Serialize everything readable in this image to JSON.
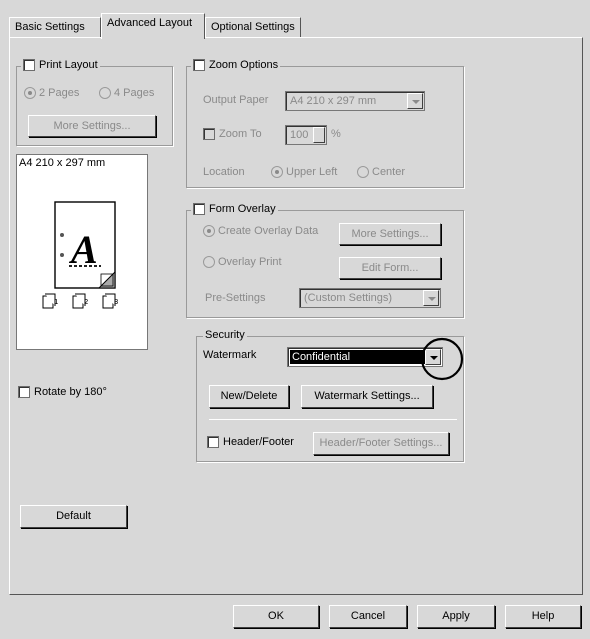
{
  "tabs": [
    "Basic Settings",
    "Advanced Layout",
    "Optional Settings"
  ],
  "print_layout": {
    "title": "Print Layout",
    "radio_2pages": "2 Pages",
    "radio_4pages": "4 Pages",
    "more_settings": "More Settings..."
  },
  "preview": {
    "paper_label": "A4 210 x 297 mm",
    "letter": "A"
  },
  "rotate": "Rotate by 180°",
  "default_button": "Default",
  "zoom": {
    "title": "Zoom Options",
    "output_paper_label": "Output Paper",
    "output_paper_value": "A4 210 x 297 mm",
    "zoom_to_label": "Zoom To",
    "zoom_value": "100",
    "percent": "%",
    "location_label": "Location",
    "upper_left": "Upper Left",
    "center": "Center"
  },
  "form_overlay": {
    "title": "Form Overlay",
    "create_overlay": "Create Overlay Data",
    "more_settings": "More Settings...",
    "overlay_print": "Overlay Print",
    "edit_form": "Edit Form...",
    "presettings_label": "Pre-Settings",
    "presettings_value": "(Custom Settings)"
  },
  "security": {
    "title": "Security",
    "watermark_label": "Watermark",
    "watermark_value": "Confidential",
    "new_delete": "New/Delete",
    "watermark_settings": "Watermark Settings...",
    "header_footer": "Header/Footer",
    "header_footer_settings": "Header/Footer Settings..."
  },
  "footer_buttons": {
    "ok": "OK",
    "cancel": "Cancel",
    "apply": "Apply",
    "help": "Help"
  },
  "colors": {
    "dialog_bg": "#d8d8d8",
    "highlight": "#000000"
  }
}
